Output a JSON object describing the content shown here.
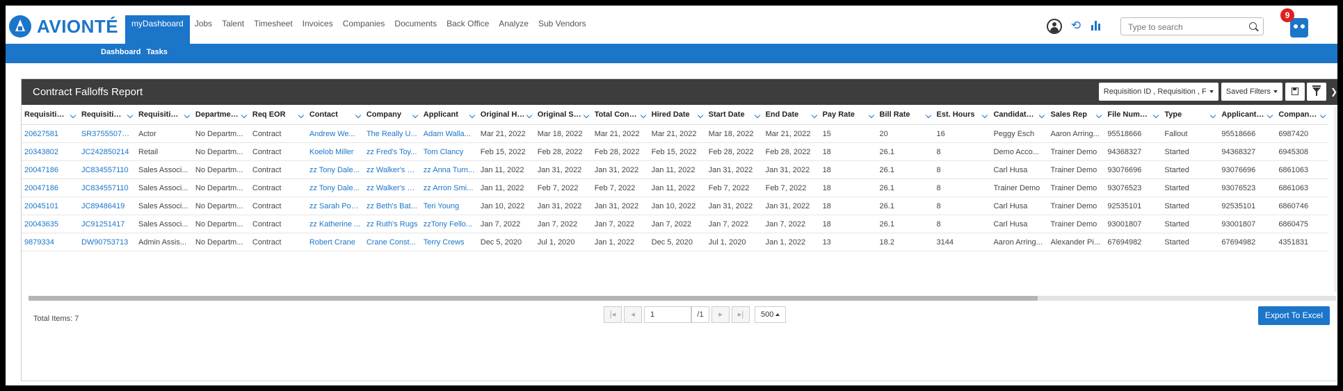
{
  "brand": {
    "name": "AVIONTÉ"
  },
  "nav": {
    "items": [
      "myDashboard",
      "Jobs",
      "Talent",
      "Timesheet",
      "Invoices",
      "Companies",
      "Documents",
      "Back Office",
      "Analyze",
      "Sub Vendors"
    ],
    "active": "myDashboard"
  },
  "subnav": {
    "items": [
      "Dashboard",
      "Tasks"
    ]
  },
  "header_right": {
    "search_placeholder": "Type to search",
    "notification_count": "9",
    "icons": [
      "user-icon",
      "refresh-icon",
      "analytics-icon",
      "search-icon",
      "assistant-bot-icon"
    ]
  },
  "report": {
    "title": "Contract Falloffs Report",
    "columns_select": "Requisition ID , Requisition , F",
    "saved_filters": "Saved Filters",
    "icons": [
      "save-icon",
      "filter-icon",
      "collapse-icon"
    ]
  },
  "table": {
    "headers": [
      "Requisition I..",
      "Requisition ..",
      "Requisition T..",
      "Department...",
      "Req EOR",
      "Contact",
      "Company",
      "Applicant",
      "Original Hire..",
      "Original Star..",
      "Total Contra..",
      "Hired Date",
      "Start Date",
      "End Date",
      "Pay Rate",
      "Bill Rate",
      "Est. Hours",
      "Candidate R..",
      "Sales Rep",
      "File Number..",
      "Type",
      "Applicant ID..",
      "Company ID.."
    ],
    "link_columns": [
      0,
      1,
      5,
      6,
      7
    ],
    "rows": [
      [
        "20627581",
        "SR3755507321",
        "Actor",
        "No Departm...",
        "Contract",
        "Andrew We...",
        "The Really U...",
        "Adam Walla...",
        "Mar 21, 2022",
        "Mar 18, 2022",
        "Mar 21, 2022",
        "Mar 21, 2022",
        "Mar 18, 2022",
        "Mar 21, 2022",
        "15",
        "20",
        "16",
        "Peggy Esch",
        "Aaron Arring...",
        "95518666",
        "Fallout",
        "95518666",
        "6987420"
      ],
      [
        "20343802",
        "JC242850214",
        "Retail",
        "No Departm...",
        "Contract",
        "Koelob Miller",
        "zz Fred's Toy...",
        "Tom Clancy",
        "Feb 15, 2022",
        "Feb 28, 2022",
        "Feb 28, 2022",
        "Feb 15, 2022",
        "Feb 28, 2022",
        "Feb 28, 2022",
        "18",
        "26.1",
        "8",
        "Demo Acco...",
        "Trainer Demo",
        "94368327",
        "Started",
        "94368327",
        "6945308"
      ],
      [
        "20047186",
        "JC834557110",
        "Sales Associ...",
        "No Departm...",
        "Contract",
        "zz Tony Dale...",
        "zz Walker's S...",
        "zz Anna Turn...",
        "Jan 11, 2022",
        "Jan 31, 2022",
        "Jan 31, 2022",
        "Jan 11, 2022",
        "Jan 31, 2022",
        "Jan 31, 2022",
        "18",
        "26.1",
        "8",
        "Carl Husa",
        "Trainer Demo",
        "93076696",
        "Started",
        "93076696",
        "6861063"
      ],
      [
        "20047186",
        "JC834557110",
        "Sales Associ...",
        "No Departm...",
        "Contract",
        "zz Tony Dale...",
        "zz Walker's S...",
        "zz Arron Smi...",
        "Jan 11, 2022",
        "Feb 7, 2022",
        "Feb 7, 2022",
        "Jan 11, 2022",
        "Feb 7, 2022",
        "Feb 7, 2022",
        "18",
        "26.1",
        "8",
        "Trainer Demo",
        "Trainer Demo",
        "93076523",
        "Started",
        "93076523",
        "6861063"
      ],
      [
        "20045101",
        "JC89486419",
        "Sales Associ...",
        "No Departm...",
        "Contract",
        "zz Sarah Pou...",
        "zz Beth's Bat...",
        "Teri Young",
        "Jan 10, 2022",
        "Jan 31, 2022",
        "Jan 31, 2022",
        "Jan 10, 2022",
        "Jan 31, 2022",
        "Jan 31, 2022",
        "18",
        "26.1",
        "8",
        "Carl Husa",
        "Trainer Demo",
        "92535101",
        "Started",
        "92535101",
        "6860746"
      ],
      [
        "20043635",
        "JC91251417",
        "Sales Associ...",
        "No Departm...",
        "Contract",
        "zz Katherine ...",
        "zz Ruth's Rugs",
        "zzTony Fello...",
        "Jan 7, 2022",
        "Jan 7, 2022",
        "Jan 7, 2022",
        "Jan 7, 2022",
        "Jan 7, 2022",
        "Jan 7, 2022",
        "18",
        "26.1",
        "8",
        "Carl Husa",
        "Trainer Demo",
        "93001807",
        "Started",
        "93001807",
        "6860475"
      ],
      [
        "9879334",
        "DW90753713",
        "Admin Assis...",
        "No Departm...",
        "Contract",
        "Robert Crane",
        "Crane Const...",
        "Terry Crews",
        "Dec 5, 2020",
        "Jul 1, 2020",
        "Jan 1, 2022",
        "Dec 5, 2020",
        "Jul 1, 2020",
        "Jan 1, 2022",
        "13",
        "18.2",
        "3144",
        "Aaron Arring...",
        "Alexander Pi...",
        "67694982",
        "Started",
        "67694982",
        "4351831"
      ]
    ]
  },
  "footer": {
    "total_label": "Total Items: 7",
    "page_value": "1",
    "page_total": "/1",
    "page_size": "500",
    "export_label": "Export To Excel",
    "pager_icons": [
      "first-page-icon",
      "prev-page-icon",
      "next-page-icon",
      "last-page-icon"
    ],
    "first_glyph": "|◂",
    "prev_glyph": "◂",
    "next_glyph": "▸",
    "last_glyph": "▸|"
  }
}
